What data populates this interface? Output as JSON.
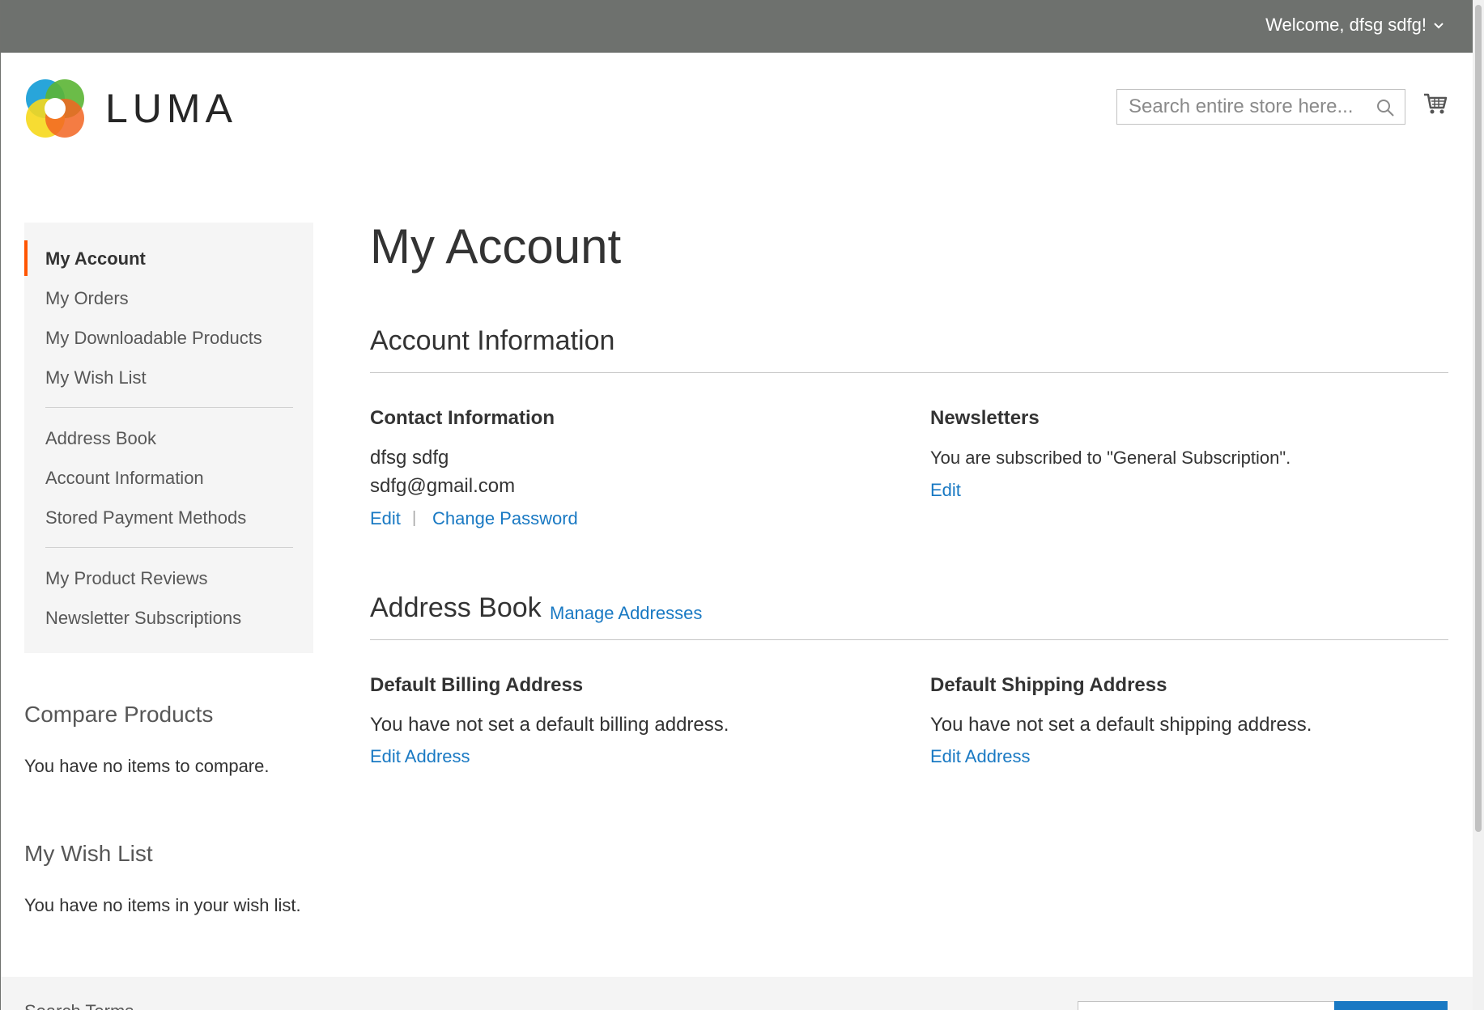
{
  "header": {
    "welcome": "Welcome, dfsg sdfg!",
    "logo_text": "LUMA",
    "search_placeholder": "Search entire store here..."
  },
  "sidebar": {
    "nav": [
      {
        "label": "My Account",
        "active": true
      },
      {
        "label": "My Orders"
      },
      {
        "label": "My Downloadable Products"
      },
      {
        "label": "My Wish List"
      },
      {
        "label": "Address Book"
      },
      {
        "label": "Account Information"
      },
      {
        "label": "Stored Payment Methods"
      },
      {
        "label": "My Product Reviews"
      },
      {
        "label": "Newsletter Subscriptions"
      }
    ],
    "compare": {
      "title": "Compare Products",
      "text": "You have no items to compare."
    },
    "wishlist": {
      "title": "My Wish List",
      "text": "You have no items in your wish list."
    }
  },
  "main": {
    "title": "My Account",
    "account_info": {
      "title": "Account Information",
      "contact": {
        "title": "Contact Information",
        "name": "dfsg sdfg",
        "email": "sdfg@gmail.com",
        "edit": "Edit",
        "separator": "|",
        "change_password": "Change Password"
      },
      "newsletters": {
        "title": "Newsletters",
        "text": "You are subscribed to \"General Subscription\".",
        "edit": "Edit"
      }
    },
    "address_book": {
      "title": "Address Book",
      "manage": "Manage Addresses",
      "billing": {
        "title": "Default Billing Address",
        "text": "You have not set a default billing address.",
        "edit": "Edit Address"
      },
      "shipping": {
        "title": "Default Shipping Address",
        "text": "You have not set a default shipping address.",
        "edit": "Edit Address"
      }
    }
  },
  "footer": {
    "search_terms": "Search Terms"
  },
  "colors": {
    "top_bar": "#6e716e",
    "accent": "#ff5501",
    "link": "#1979c3",
    "sidebar_bg": "#f5f5f5"
  },
  "icons": {
    "logo": "luma-logo-icon",
    "search": "search-icon",
    "cart": "cart-icon",
    "dropdown": "chevron-down-icon"
  }
}
